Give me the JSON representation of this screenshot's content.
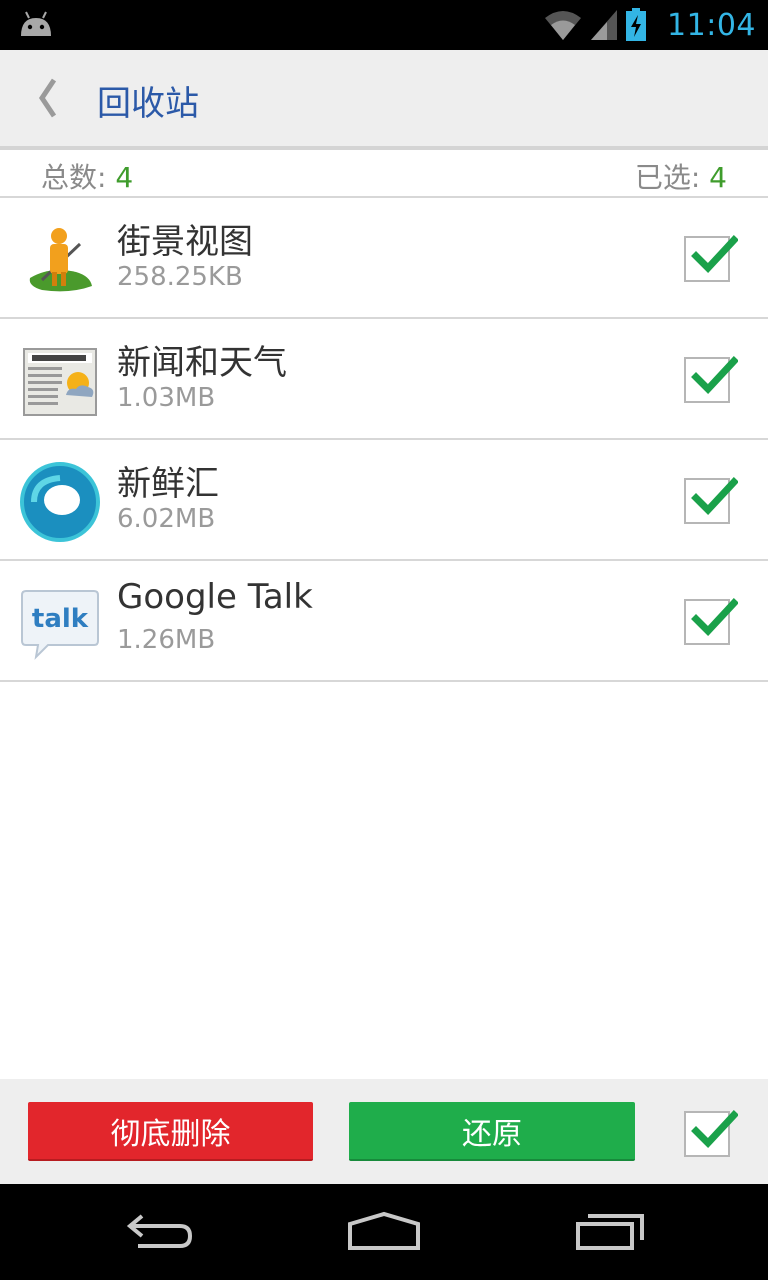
{
  "status_bar": {
    "time": "11:04",
    "icons": [
      "android-icon",
      "wifi-icon",
      "signal-icon",
      "battery-charging-icon"
    ]
  },
  "header": {
    "back_icon": "chevron-left-icon",
    "title": "回收站"
  },
  "summary": {
    "total_label": "总数: ",
    "total_count": "4",
    "selected_label": "已选: ",
    "selected_count": "4"
  },
  "apps": [
    {
      "name": "街景视图",
      "size": "258.25KB",
      "icon": "street-view-icon",
      "checked": true
    },
    {
      "name": "新闻和天气",
      "size": "1.03MB",
      "icon": "news-weather-icon",
      "checked": true
    },
    {
      "name": "新鲜汇",
      "size": "6.02MB",
      "icon": "currents-icon",
      "checked": true
    },
    {
      "name": "Google Talk",
      "size": "1.26MB",
      "icon": "talk-icon",
      "checked": true
    }
  ],
  "actions": {
    "delete_label": "彻底删除",
    "restore_label": "还原",
    "select_all_checked": true
  },
  "nav_bar": {
    "icons": [
      "back-icon",
      "home-icon",
      "recents-icon"
    ]
  },
  "colors": {
    "accent_title": "#2b59a8",
    "count_green": "#3f9c2c",
    "check_green": "#1aa14a",
    "delete_red": "#e2262c",
    "restore_green": "#1fad4b",
    "status_time": "#33b5e5"
  }
}
